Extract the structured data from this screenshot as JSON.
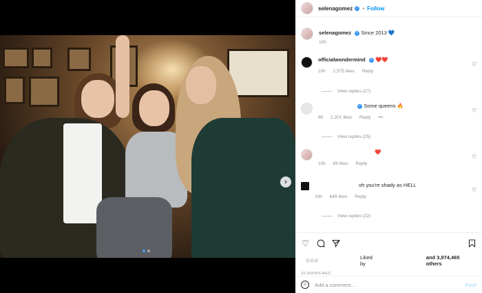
{
  "header": {
    "username": "selenagomez",
    "verified_icon": "verified-badge-icon",
    "separator": "•",
    "follow_label": "Follow"
  },
  "caption": {
    "username": "selenagomez",
    "text": "Since 2013",
    "emoji": "💙",
    "time": "10h"
  },
  "comments": [
    {
      "username": "officialwondermind",
      "verified": true,
      "text": "❤️❤️",
      "time": "10h",
      "likes": "2,575 likes",
      "reply": "Reply",
      "view_replies": "View replies (27)"
    },
    {
      "username": "",
      "verified": true,
      "text": "Some queens 🔥",
      "time": "9h",
      "likes": "2,201 likes",
      "reply": "Reply",
      "more": "•••",
      "view_replies": "View replies (25)"
    },
    {
      "username": "",
      "verified": false,
      "text": "❤️",
      "time": "10h",
      "likes": "69 likes",
      "reply": "Reply"
    },
    {
      "username": "",
      "verified": false,
      "text": "oh you're shady as HELL",
      "time": "10h",
      "likes": "649 likes",
      "reply": "Reply",
      "view_replies": "View replies (22)"
    }
  ],
  "actions": {
    "liked_by": "Liked by",
    "and_others": "and 3,974,465 others",
    "timestamp": "10 HOURS AGO"
  },
  "comment_box": {
    "placeholder": "Add a comment...",
    "post_label": "Post"
  },
  "media": {
    "carousel_index": 0,
    "carousel_count": 2
  },
  "colors": {
    "accent": "#0095f6",
    "verified": "#3897f0",
    "like_red": "#ed4956"
  }
}
